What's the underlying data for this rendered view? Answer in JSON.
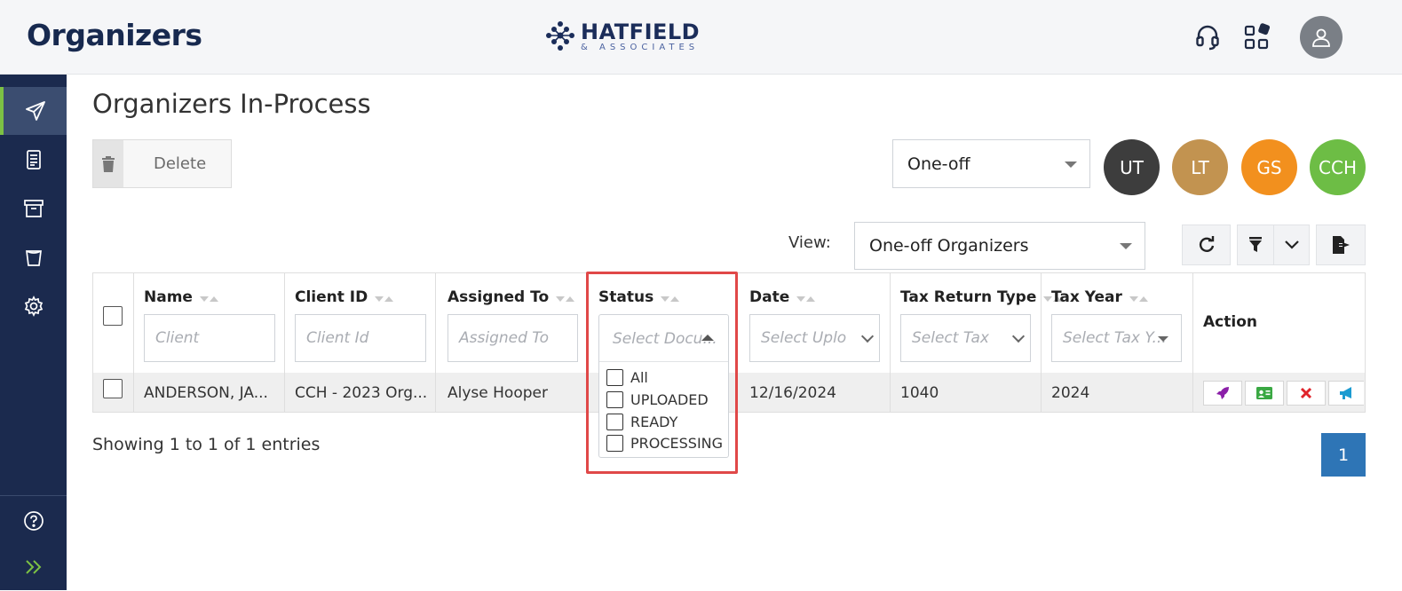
{
  "header": {
    "app_title": "Organizers",
    "logo_main": "HATFIELD",
    "logo_sub": "& ASSOCIATES",
    "icons": [
      "headset-icon",
      "apps-grid-icon",
      "user-avatar-icon"
    ]
  },
  "sidebar": {
    "items": [
      {
        "icon": "send-icon",
        "active": true
      },
      {
        "icon": "document-icon",
        "active": false
      },
      {
        "icon": "archive-icon",
        "active": false
      },
      {
        "icon": "trash-bin-icon",
        "active": false
      },
      {
        "icon": "gear-icon",
        "active": false
      }
    ],
    "bottom_items": [
      {
        "icon": "help-icon"
      },
      {
        "icon": "expand-icon"
      }
    ]
  },
  "page": {
    "title": "Organizers In-Process",
    "delete_label": "Delete",
    "type_select": "One-off",
    "integrations": [
      {
        "label": "UT",
        "color": "#3d3d3d"
      },
      {
        "label": "LT",
        "color": "#c29350"
      },
      {
        "label": "GS",
        "color": "#f2901e"
      },
      {
        "label": "CCH",
        "color": "#6dbd45"
      }
    ],
    "view_label": "View:",
    "view_select": "One-off Organizers"
  },
  "table": {
    "columns": [
      {
        "label": "Name",
        "placeholder": "Client"
      },
      {
        "label": "Client ID",
        "placeholder": "Client Id"
      },
      {
        "label": "Assigned To",
        "placeholder": "Assigned To"
      },
      {
        "label": "Status",
        "placeholder": "Select Docu..."
      },
      {
        "label": "Date",
        "placeholder": "Select Uplo"
      },
      {
        "label": "Tax Return Type",
        "placeholder": "Select Tax"
      },
      {
        "label": "Tax Year",
        "placeholder": "Select Tax Y..."
      },
      {
        "label": "Action"
      }
    ],
    "rows": [
      {
        "name": "ANDERSON, JA...",
        "client_id": "CCH - 2023 Org...",
        "assigned_to": "Alyse Hooper",
        "status": "",
        "date": "12/16/2024",
        "tax_return_type": "1040",
        "tax_year": "2024",
        "actions": [
          "rocket-icon",
          "id-card-icon",
          "close-icon",
          "megaphone-icon"
        ]
      }
    ]
  },
  "status_dropdown": {
    "options": [
      "All",
      "UPLOADED",
      "READY",
      "PROCESSING"
    ]
  },
  "footer": {
    "entries_text": "Showing 1 to 1 of 1 entries",
    "current_page": "1"
  },
  "colors": {
    "sidebar_bg": "#1b2a4e",
    "accent_green": "#7cc144",
    "highlight_red": "#e04848",
    "pagination_blue": "#2e75b6"
  }
}
